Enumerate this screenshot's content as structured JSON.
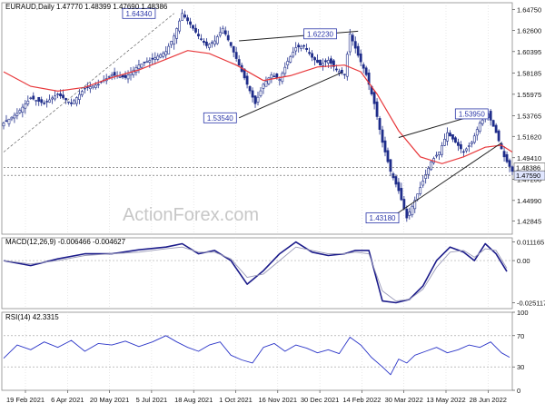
{
  "chart_data": [
    {
      "panel": "price",
      "type": "candlestick",
      "header": "EURAUD,Daily  1.47770 1.48399 1.47690 1.48386",
      "watermark": "ActionForex.com",
      "ylim": [
        1.415,
        1.6545
      ],
      "y_ticks": [
        "1.64750",
        "1.62600",
        "1.60395",
        "1.58185",
        "1.55975",
        "1.53765",
        "1.51620",
        "1.49410",
        "1.47200",
        "1.44990",
        "1.42845"
      ],
      "price_tags": [
        "1.48386",
        "1.47590"
      ],
      "close_path": [
        [
          0,
          1.53
        ],
        [
          5,
          1.54
        ],
        [
          10,
          1.556
        ],
        [
          15,
          1.55
        ],
        [
          20,
          1.56
        ],
        [
          25,
          1.55
        ],
        [
          30,
          1.566
        ],
        [
          35,
          1.57
        ],
        [
          40,
          1.58
        ],
        [
          45,
          1.577
        ],
        [
          50,
          1.59
        ],
        [
          55,
          1.596
        ],
        [
          60,
          1.604
        ],
        [
          63,
          1.62
        ],
        [
          66,
          1.6434
        ],
        [
          69,
          1.632
        ],
        [
          72,
          1.62
        ],
        [
          75,
          1.61
        ],
        [
          78,
          1.615
        ],
        [
          81,
          1.628
        ],
        [
          84,
          1.61
        ],
        [
          87,
          1.59
        ],
        [
          90,
          1.57
        ],
        [
          93,
          1.55
        ],
        [
          96,
          1.57
        ],
        [
          99,
          1.58
        ],
        [
          102,
          1.575
        ],
        [
          105,
          1.594
        ],
        [
          108,
          1.608
        ],
        [
          111,
          1.61
        ],
        [
          114,
          1.598
        ],
        [
          117,
          1.59
        ],
        [
          120,
          1.595
        ],
        [
          123,
          1.585
        ],
        [
          126,
          1.58
        ],
        [
          128,
          1.6223
        ],
        [
          131,
          1.6
        ],
        [
          134,
          1.58
        ],
        [
          137,
          1.55
        ],
        [
          140,
          1.51
        ],
        [
          143,
          1.48
        ],
        [
          146,
          1.46
        ],
        [
          149,
          1.4318
        ],
        [
          152,
          1.45
        ],
        [
          155,
          1.47
        ],
        [
          158,
          1.49
        ],
        [
          161,
          1.5
        ],
        [
          164,
          1.52
        ],
        [
          167,
          1.51
        ],
        [
          170,
          1.5
        ],
        [
          173,
          1.51
        ],
        [
          176,
          1.53
        ],
        [
          179,
          1.5395
        ],
        [
          182,
          1.52
        ],
        [
          185,
          1.495
        ],
        [
          188,
          1.48
        ]
      ],
      "ma_path": [
        [
          0,
          1.583
        ],
        [
          10,
          1.568
        ],
        [
          20,
          1.563
        ],
        [
          30,
          1.567
        ],
        [
          40,
          1.577
        ],
        [
          50,
          1.585
        ],
        [
          60,
          1.596
        ],
        [
          68,
          1.605
        ],
        [
          76,
          1.602
        ],
        [
          86,
          1.59
        ],
        [
          96,
          1.574
        ],
        [
          106,
          1.579
        ],
        [
          116,
          1.588
        ],
        [
          126,
          1.59
        ],
        [
          132,
          1.583
        ],
        [
          138,
          1.56
        ],
        [
          146,
          1.522
        ],
        [
          154,
          1.495
        ],
        [
          162,
          1.488
        ],
        [
          170,
          1.495
        ],
        [
          178,
          1.505
        ],
        [
          184,
          1.507
        ],
        [
          188,
          1.5
        ]
      ],
      "labels": [
        {
          "text": "1.64340",
          "x": 50,
          "y": 1.6434
        },
        {
          "text": "1.62230",
          "x": 117,
          "y": 1.6223
        },
        {
          "text": "1.53540",
          "x": 80,
          "y": 1.5354
        },
        {
          "text": "1.53950",
          "x": 173,
          "y": 1.5395
        },
        {
          "text": "1.43180",
          "x": 140,
          "y": 1.4318
        }
      ],
      "trendlines": [
        {
          "x1": 0,
          "y1": 1.5,
          "x2": 63,
          "y2": 1.6434,
          "style": "dashed"
        },
        {
          "x1": 87,
          "y1": 1.615,
          "x2": 131,
          "y2": 1.625,
          "style": "solid"
        },
        {
          "x1": 87,
          "y1": 1.5354,
          "x2": 125,
          "y2": 1.5822,
          "style": "solid"
        },
        {
          "x1": 143,
          "y1": 1.4318,
          "x2": 184,
          "y2": 1.5095,
          "style": "solid"
        },
        {
          "x1": 146,
          "y1": 1.515,
          "x2": 179,
          "y2": 1.542,
          "style": "solid"
        }
      ]
    },
    {
      "panel": "macd",
      "type": "line",
      "header": "MACD(12,26,9) -0.006466 -0.004627",
      "ylim": [
        -0.0285,
        0.0135
      ],
      "y_ticks": [
        "0.011165",
        "0.00",
        "-0.025117"
      ],
      "series": [
        {
          "role": "macd",
          "values": [
            [
              0,
              0.0
            ],
            [
              10,
              -0.003
            ],
            [
              20,
              0.001
            ],
            [
              30,
              0.004
            ],
            [
              40,
              0.004
            ],
            [
              50,
              0.0064
            ],
            [
              60,
              0.008
            ],
            [
              66,
              0.01
            ],
            [
              72,
              0.004
            ],
            [
              78,
              0.006
            ],
            [
              84,
              0.0
            ],
            [
              90,
              -0.014
            ],
            [
              96,
              -0.006
            ],
            [
              102,
              0.004
            ],
            [
              108,
              0.011
            ],
            [
              114,
              0.005
            ],
            [
              120,
              0.003
            ],
            [
              126,
              0.004
            ],
            [
              130,
              0.006
            ],
            [
              135,
              0.006
            ],
            [
              140,
              -0.024
            ],
            [
              145,
              -0.025
            ],
            [
              150,
              -0.023
            ],
            [
              155,
              -0.015
            ],
            [
              160,
              0.0
            ],
            [
              165,
              0.008
            ],
            [
              170,
              0.005
            ],
            [
              174,
              0.0
            ],
            [
              178,
              0.01
            ],
            [
              182,
              0.004
            ],
            [
              186,
              -0.0065
            ]
          ]
        },
        {
          "role": "signal",
          "values": [
            [
              0,
              0.0
            ],
            [
              10,
              -0.002
            ],
            [
              20,
              0.0
            ],
            [
              30,
              0.003
            ],
            [
              40,
              0.004
            ],
            [
              50,
              0.005
            ],
            [
              60,
              0.007
            ],
            [
              66,
              0.008
            ],
            [
              72,
              0.005
            ],
            [
              78,
              0.005
            ],
            [
              84,
              0.001
            ],
            [
              90,
              -0.01
            ],
            [
              96,
              -0.008
            ],
            [
              102,
              0.0
            ],
            [
              108,
              0.008
            ],
            [
              114,
              0.006
            ],
            [
              120,
              0.004
            ],
            [
              126,
              0.004
            ],
            [
              130,
              0.005
            ],
            [
              135,
              0.004
            ],
            [
              140,
              -0.018
            ],
            [
              145,
              -0.024
            ],
            [
              150,
              -0.023
            ],
            [
              155,
              -0.017
            ],
            [
              160,
              -0.004
            ],
            [
              165,
              0.005
            ],
            [
              170,
              0.006
            ],
            [
              174,
              0.002
            ],
            [
              178,
              0.007
            ],
            [
              182,
              0.006
            ],
            [
              186,
              -0.0046
            ]
          ]
        }
      ]
    },
    {
      "panel": "rsi",
      "type": "line",
      "header": "RSI(14) 42.3315",
      "ylim": [
        0,
        100
      ],
      "y_ticks": [
        "100",
        "70",
        "30",
        "0"
      ],
      "levels": [
        70,
        30
      ],
      "values": [
        [
          0,
          41
        ],
        [
          5,
          58
        ],
        [
          10,
          52
        ],
        [
          15,
          62
        ],
        [
          20,
          55
        ],
        [
          25,
          64
        ],
        [
          30,
          50
        ],
        [
          35,
          60
        ],
        [
          40,
          58
        ],
        [
          45,
          63
        ],
        [
          50,
          56
        ],
        [
          55,
          62
        ],
        [
          60,
          70
        ],
        [
          64,
          62
        ],
        [
          68,
          55
        ],
        [
          72,
          50
        ],
        [
          76,
          58
        ],
        [
          80,
          62
        ],
        [
          84,
          45
        ],
        [
          88,
          39
        ],
        [
          92,
          35
        ],
        [
          96,
          55
        ],
        [
          100,
          60
        ],
        [
          104,
          50
        ],
        [
          108,
          58
        ],
        [
          112,
          54
        ],
        [
          116,
          48
        ],
        [
          120,
          52
        ],
        [
          124,
          47
        ],
        [
          128,
          68
        ],
        [
          132,
          58
        ],
        [
          136,
          42
        ],
        [
          140,
          30
        ],
        [
          143,
          20
        ],
        [
          146,
          40
        ],
        [
          149,
          35
        ],
        [
          152,
          45
        ],
        [
          156,
          50
        ],
        [
          160,
          55
        ],
        [
          164,
          48
        ],
        [
          168,
          52
        ],
        [
          172,
          58
        ],
        [
          176,
          55
        ],
        [
          180,
          62
        ],
        [
          184,
          48
        ],
        [
          187,
          42.3
        ]
      ]
    }
  ],
  "x_axis": {
    "ticks": [
      "19 Feb 2021",
      "6 Apr 2021",
      "20 May 2021",
      "5 Jul 2021",
      "18 Aug 2021",
      "1 Oct 2021",
      "16 Nov 2021",
      "30 Dec 2021",
      "14 Feb 2022",
      "30 Mar 2022",
      "13 May 2022",
      "28 Jun 2022"
    ]
  },
  "colors": {
    "candle": "#1f2d8a",
    "ma": "#e8383b",
    "macd": "#1b1b8a",
    "signal": "#9a9ab8",
    "rsi": "#2b35c8",
    "labelbox": "#2a36a8",
    "grid": "#d9d9d9",
    "frame": "#8a8a8a"
  }
}
